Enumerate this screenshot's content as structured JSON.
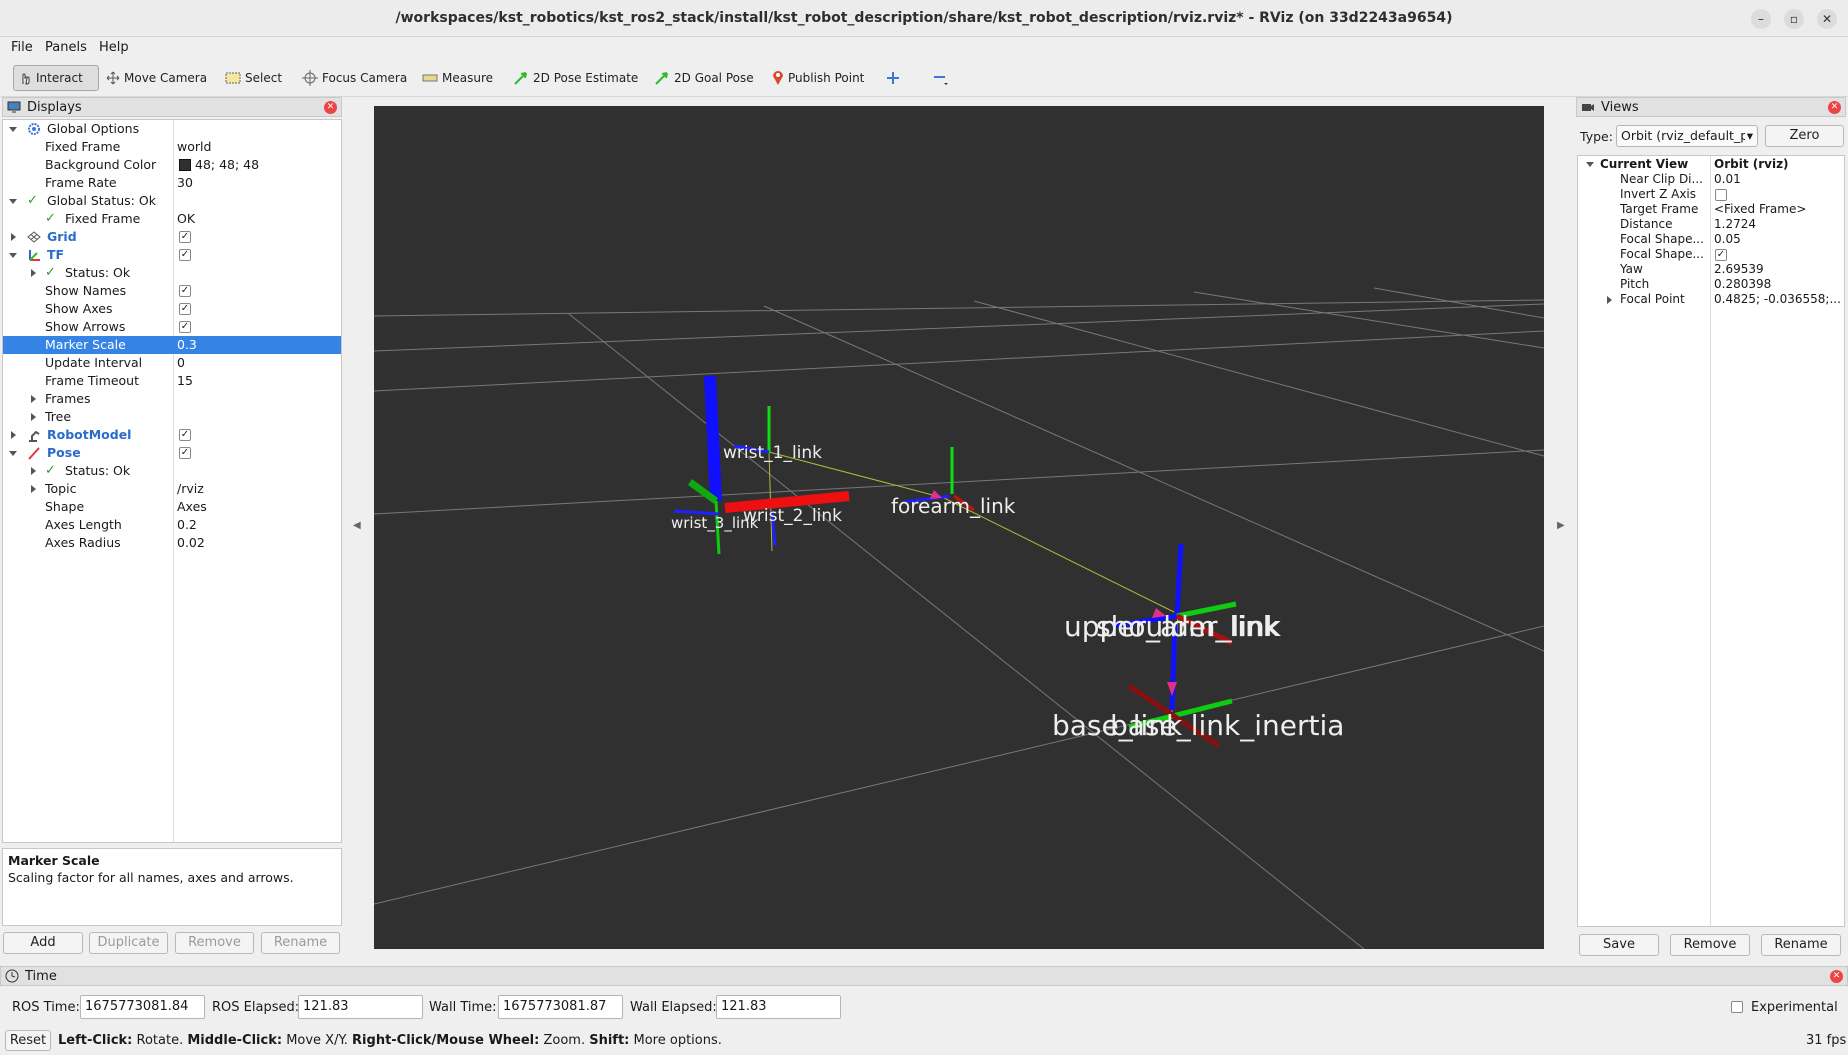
{
  "window": {
    "title": "/workspaces/kst_robotics/kst_ros2_stack/install/kst_robot_description/share/kst_robot_description/rviz.rviz* - RViz (on 33d2243a9654)",
    "controls": [
      "–",
      "▫",
      "✕"
    ]
  },
  "menu": [
    "File",
    "Panels",
    "Help"
  ],
  "toolbar": {
    "interact": "Interact",
    "move_camera": "Move Camera",
    "select": "Select",
    "focus_camera": "Focus Camera",
    "measure": "Measure",
    "pose_estimate": "2D Pose Estimate",
    "goal_pose": "2D Goal Pose",
    "publish_point": "Publish Point"
  },
  "displays": {
    "title": "Displays",
    "rows": {
      "global_options": "Global Options",
      "fixed_frame": {
        "name": "Fixed Frame",
        "value": "world"
      },
      "background_color": {
        "name": "Background Color",
        "value": "48; 48; 48",
        "swatch": "#303030"
      },
      "frame_rate": {
        "name": "Frame Rate",
        "value": "30"
      },
      "global_status": "Global Status: Ok",
      "gs_fixed_frame": {
        "name": "Fixed Frame",
        "value": "OK"
      },
      "grid": "Grid",
      "tf": "TF",
      "tf_status": "Status: Ok",
      "show_names": "Show Names",
      "show_axes": "Show Axes",
      "show_arrows": "Show Arrows",
      "marker_scale": {
        "name": "Marker Scale",
        "value": "0.3"
      },
      "update_interval": {
        "name": "Update Interval",
        "value": "0"
      },
      "frame_timeout": {
        "name": "Frame Timeout",
        "value": "15"
      },
      "frames": "Frames",
      "tree": "Tree",
      "robot_model": "RobotModel",
      "pose": "Pose",
      "pose_status": "Status: Ok",
      "topic": {
        "name": "Topic",
        "value": "/rviz"
      },
      "shape": {
        "name": "Shape",
        "value": "Axes"
      },
      "axes_length": {
        "name": "Axes Length",
        "value": "0.2"
      },
      "axes_radius": {
        "name": "Axes Radius",
        "value": "0.02"
      }
    },
    "description": {
      "title": "Marker Scale",
      "text": "Scaling factor for all names, axes and arrows."
    },
    "buttons": {
      "add": "Add",
      "duplicate": "Duplicate",
      "remove": "Remove",
      "rename": "Rename"
    }
  },
  "scene": {
    "labels": {
      "wrist1": "wrist_1_link",
      "wrist2": "wrist_2_link",
      "wrist3": "wrist_3_link",
      "forearm": "forearm_link",
      "upper_arm": "upper_arm_link",
      "shoulder": "shoulder_link",
      "base": "base_link",
      "base_inertia": "base_link_inertia"
    }
  },
  "views": {
    "title": "Views",
    "type_label": "Type:",
    "type_value": "Orbit (rviz_default_p",
    "zero": "Zero",
    "current_view": {
      "name": "Current View",
      "value": "Orbit (rviz)"
    },
    "props": [
      {
        "name": "Near Clip Di...",
        "value": "0.01"
      },
      {
        "name": "Invert Z Axis",
        "value": ""
      },
      {
        "name": "Target Frame",
        "value": "<Fixed Frame>"
      },
      {
        "name": "Distance",
        "value": "1.2724"
      },
      {
        "name": "Focal Shape...",
        "value": "0.05"
      },
      {
        "name": "Focal Shape...",
        "value": ""
      },
      {
        "name": "Yaw",
        "value": "2.69539"
      },
      {
        "name": "Pitch",
        "value": "0.280398"
      },
      {
        "name": "Focal Point",
        "value": "0.4825; -0.036558;..."
      }
    ],
    "buttons": {
      "save": "Save",
      "remove": "Remove",
      "rename": "Rename"
    }
  },
  "time": {
    "title": "Time",
    "ros_time_label": "ROS Time:",
    "ros_time": "1675773081.84",
    "ros_elapsed_label": "ROS Elapsed:",
    "ros_elapsed": "121.83",
    "wall_time_label": "Wall Time:",
    "wall_time": "1675773081.87",
    "wall_elapsed_label": "Wall Elapsed:",
    "wall_elapsed": "121.83",
    "experimental": "Experimental"
  },
  "status": {
    "reset": "Reset",
    "left_click": "Left-Click:",
    "left_click_text": "Rotate.",
    "middle_click": "Middle-Click:",
    "middle_click_text": "Move X/Y.",
    "right_click": "Right-Click/Mouse Wheel:",
    "right_click_text": "Zoom.",
    "shift": "Shift:",
    "shift_text": "More options.",
    "fps": "31 fps"
  }
}
